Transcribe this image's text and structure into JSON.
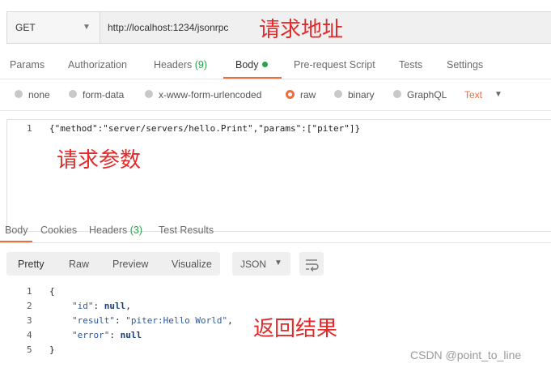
{
  "request": {
    "method": "GET",
    "url": "http://localhost:1234/jsonrpc",
    "annotation": "请求地址"
  },
  "tabs": [
    {
      "label": "Params"
    },
    {
      "label": "Authorization"
    },
    {
      "label": "Headers",
      "count": "(9)"
    },
    {
      "label": "Body"
    },
    {
      "label": "Pre-request Script"
    },
    {
      "label": "Tests"
    },
    {
      "label": "Settings"
    }
  ],
  "body_types": [
    "none",
    "form-data",
    "x-www-form-urlencoded",
    "raw",
    "binary",
    "GraphQL"
  ],
  "body_format": "Text",
  "editor": {
    "line": "1",
    "code": "{\"method\":\"server/servers/hello.Print\",\"params\":[\"piter\"]}",
    "annotation": "请求参数"
  },
  "response_tabs": [
    {
      "label": "Body"
    },
    {
      "label": "Cookies"
    },
    {
      "label": "Headers",
      "count": "(3)"
    },
    {
      "label": "Test Results"
    }
  ],
  "response_views": [
    "Pretty",
    "Raw",
    "Preview",
    "Visualize"
  ],
  "response_format": "JSON",
  "response": {
    "line_numbers": [
      "1",
      "2",
      "3",
      "4",
      "5"
    ],
    "open_brace": "{",
    "close_brace": "}",
    "id_key": "\"id\"",
    "id_value": "null",
    "result_key": "\"result\"",
    "result_value": "\"piter:Hello World\"",
    "error_key": "\"error\"",
    "error_value": "null",
    "annotation": "返回结果"
  },
  "watermark": "CSDN @point_to_line",
  "colors": {
    "accent": "#f26b3a",
    "annotation": "#e32a2a",
    "green": "#2aa14d"
  }
}
